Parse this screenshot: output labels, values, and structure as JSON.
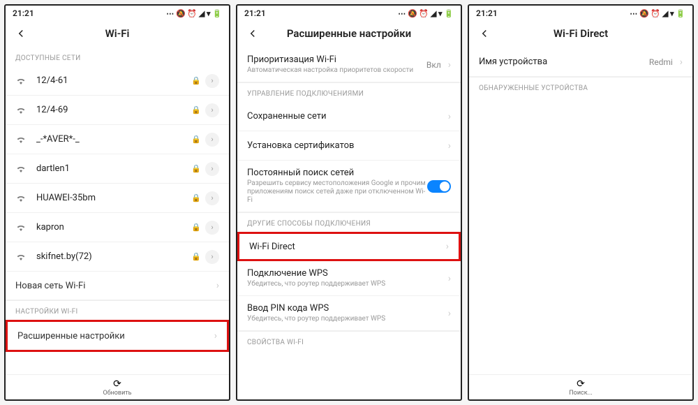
{
  "status": {
    "time": "21:21"
  },
  "screen1": {
    "title": "Wi-Fi",
    "sections": {
      "available": "ДОСТУПНЫЕ СЕТИ",
      "settings": "НАСТРОЙКИ WI-FI"
    },
    "networks": [
      {
        "name": "12/4-61"
      },
      {
        "name": "12/4-69"
      },
      {
        "name": "_-*AVER*-_"
      },
      {
        "name": "dartlen1"
      },
      {
        "name": "HUAWEI-35bm"
      },
      {
        "name": "kapron"
      },
      {
        "name": "skifnet.by(72)"
      }
    ],
    "newNetwork": "Новая сеть Wi-Fi",
    "advanced": "Расширенные настройки",
    "refresh": "Обновить"
  },
  "screen2": {
    "title": "Расширенные настройки",
    "priority": {
      "title": "Приоритизация Wi-Fi",
      "sub": "Автоматическая настройка приоритетов скорости",
      "value": "Вкл"
    },
    "sectionConn": "УПРАВЛЕНИЕ ПОДКЛЮЧЕНИЯМИ",
    "saved": "Сохраненные сети",
    "certs": "Установка сертификатов",
    "scan": {
      "title": "Постоянный поиск сетей",
      "sub": "Разрешить сервису местоположения Google и прочим приложениям поиск сетей даже при отключенном Wi-Fi"
    },
    "sectionOther": "ДРУГИЕ СПОСОБЫ ПОДКЛЮЧЕНИЯ",
    "direct": "Wi-Fi Direct",
    "wps": {
      "title": "Подключение WPS",
      "sub": "Убедитесь, что роутер поддерживает WPS"
    },
    "wpspin": {
      "title": "Ввод PIN кода WPS",
      "sub": "Убедитесь, что роутер поддерживает WPS"
    },
    "sectionProps": "СВОЙСТВА WI-FI"
  },
  "screen3": {
    "title": "Wi-Fi Direct",
    "devName": {
      "label": "Имя устройства",
      "value": "Redmi"
    },
    "discovered": "ОБНАРУЖЕННЫЕ УСТРОЙСТВА",
    "search": "Поиск..."
  }
}
